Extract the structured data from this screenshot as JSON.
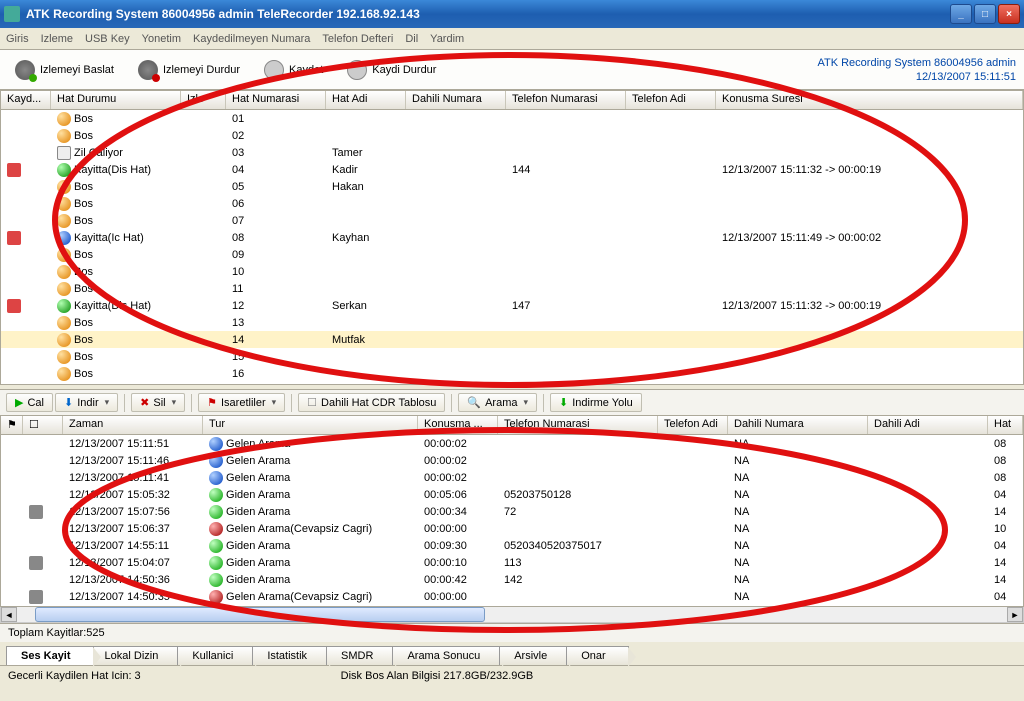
{
  "window": {
    "title": "ATK Recording System 86004956 admin TeleRecorder 192.168.92.143"
  },
  "menu": [
    "Giris",
    "Izleme",
    "USB Key",
    "Yonetim",
    "Kaydedilmeyen Numara",
    "Telefon Defteri",
    "Dil",
    "Yardim"
  ],
  "toolbar": {
    "items": [
      {
        "icon": "headphone-green",
        "label": "Izlemeyi Baslat"
      },
      {
        "icon": "headphone-red",
        "label": "Izlemeyi Durdur"
      },
      {
        "icon": "disk",
        "label": "Kaydet"
      },
      {
        "icon": "disk",
        "label": "Kaydi Durdur"
      }
    ],
    "right1": "ATK Recording System 86004956 admin",
    "right2": "12/13/2007 15:11:51"
  },
  "upper": {
    "headers": [
      "Kayd...",
      "Hat Durumu",
      "Izle",
      "Hat Numarasi",
      "Hat Adi",
      "Dahili Numara",
      "Telefon Numarasi",
      "Telefon Adi",
      "Konusma Suresi"
    ],
    "rows": [
      {
        "rec": "",
        "icon": "orange",
        "durum": "Bos",
        "izle": "",
        "hatno": "01",
        "hatadi": "",
        "dahili": "",
        "tel": "",
        "teladi": "",
        "sure": ""
      },
      {
        "rec": "",
        "icon": "orange",
        "durum": "Bos",
        "izle": "",
        "hatno": "02",
        "hatadi": "",
        "dahili": "",
        "tel": "",
        "teladi": "",
        "sure": ""
      },
      {
        "rec": "",
        "icon": "note",
        "durum": "Zil Caliyor",
        "izle": "",
        "hatno": "03",
        "hatadi": "Tamer",
        "dahili": "",
        "tel": "",
        "teladi": "",
        "sure": ""
      },
      {
        "rec": "r",
        "icon": "greenphone",
        "durum": "Kayitta(Dis Hat)",
        "izle": "",
        "hatno": "04",
        "hatadi": "Kadir",
        "dahili": "",
        "tel": "144",
        "teladi": "",
        "sure": "12/13/2007 15:11:32  -> 00:00:19"
      },
      {
        "rec": "",
        "icon": "orange",
        "durum": "Bos",
        "izle": "",
        "hatno": "05",
        "hatadi": "Hakan",
        "dahili": "",
        "tel": "",
        "teladi": "",
        "sure": ""
      },
      {
        "rec": "",
        "icon": "orange",
        "durum": "Bos",
        "izle": "",
        "hatno": "06",
        "hatadi": "",
        "dahili": "",
        "tel": "",
        "teladi": "",
        "sure": ""
      },
      {
        "rec": "",
        "icon": "orange",
        "durum": "Bos",
        "izle": "",
        "hatno": "07",
        "hatadi": "",
        "dahili": "",
        "tel": "",
        "teladi": "",
        "sure": ""
      },
      {
        "rec": "r",
        "icon": "bluephone",
        "durum": "Kayitta(Ic Hat)",
        "izle": "",
        "hatno": "08",
        "hatadi": "Kayhan",
        "dahili": "",
        "tel": "",
        "teladi": "",
        "sure": "12/13/2007 15:11:49  -> 00:00:02"
      },
      {
        "rec": "",
        "icon": "orange",
        "durum": "Bos",
        "izle": "",
        "hatno": "09",
        "hatadi": "",
        "dahili": "",
        "tel": "",
        "teladi": "",
        "sure": ""
      },
      {
        "rec": "",
        "icon": "orange",
        "durum": "Bos",
        "izle": "",
        "hatno": "10",
        "hatadi": "",
        "dahili": "",
        "tel": "",
        "teladi": "",
        "sure": ""
      },
      {
        "rec": "",
        "icon": "orange",
        "durum": "Bos",
        "izle": "",
        "hatno": "11",
        "hatadi": "",
        "dahili": "",
        "tel": "",
        "teladi": "",
        "sure": ""
      },
      {
        "rec": "r",
        "icon": "greenphone",
        "durum": "Kayitta(Dis Hat)",
        "izle": "",
        "hatno": "12",
        "hatadi": "Serkan",
        "dahili": "",
        "tel": "147",
        "teladi": "",
        "sure": "12/13/2007 15:11:32  -> 00:00:19"
      },
      {
        "rec": "",
        "icon": "orange",
        "durum": "Bos",
        "izle": "",
        "hatno": "13",
        "hatadi": "",
        "dahili": "",
        "tel": "",
        "teladi": "",
        "sure": ""
      },
      {
        "rec": "",
        "icon": "orange",
        "durum": "Bos",
        "izle": "",
        "hatno": "14",
        "hatadi": "Mutfak",
        "dahili": "",
        "tel": "",
        "teladi": "",
        "sure": "",
        "sel": true
      },
      {
        "rec": "",
        "icon": "orange",
        "durum": "Bos",
        "izle": "",
        "hatno": "15",
        "hatadi": "",
        "dahili": "",
        "tel": "",
        "teladi": "",
        "sure": ""
      },
      {
        "rec": "",
        "icon": "orange",
        "durum": "Bos",
        "izle": "",
        "hatno": "16",
        "hatadi": "",
        "dahili": "",
        "tel": "",
        "teladi": "",
        "sure": ""
      }
    ]
  },
  "ltoolbar": [
    {
      "label": "Cal",
      "color": "#0a0",
      "glyph": "▶"
    },
    {
      "label": "Indir",
      "color": "#06c",
      "glyph": "⬇",
      "dd": true
    },
    {
      "sep": true
    },
    {
      "label": "Sil",
      "color": "#c00",
      "glyph": "✖",
      "dd": true
    },
    {
      "sep": true
    },
    {
      "label": "Isaretliler",
      "color": "#c00",
      "glyph": "⚑",
      "dd": true
    },
    {
      "sep": true
    },
    {
      "label": "Dahili Hat CDR Tablosu",
      "color": "#888",
      "glyph": "☐"
    },
    {
      "sep": true
    },
    {
      "label": "Arama",
      "color": "#06c",
      "glyph": "🔍",
      "dd": true
    },
    {
      "sep": true
    },
    {
      "label": "Indirme Yolu",
      "color": "#0a0",
      "glyph": "⬇"
    }
  ],
  "lower": {
    "headers": [
      "⚑",
      "☐",
      "Zaman",
      "Tur",
      "Konusma ...",
      "Telefon Numarasi",
      "Telefon Adi",
      "Dahili Numara",
      "Dahili Adi",
      "Hat"
    ],
    "rows": [
      {
        "f": "",
        "c": "",
        "zaman": "12/13/2007 15:11:51",
        "ticon": "bluephone",
        "tur": "Gelen Arama",
        "kon": "00:00:02",
        "tel": "",
        "tadi": "",
        "dahili": "NA",
        "dadi": "",
        "hat": "08"
      },
      {
        "f": "",
        "c": "",
        "zaman": "12/13/2007 15:11:46",
        "ticon": "bluephone",
        "tur": "Gelen Arama",
        "kon": "00:00:02",
        "tel": "",
        "tadi": "",
        "dahili": "NA",
        "dadi": "",
        "hat": "08"
      },
      {
        "f": "",
        "c": "",
        "zaman": "12/13/2007 15:11:41",
        "ticon": "bluephone",
        "tur": "Gelen Arama",
        "kon": "00:00:02",
        "tel": "",
        "tadi": "",
        "dahili": "NA",
        "dadi": "",
        "hat": "08"
      },
      {
        "f": "",
        "c": "",
        "zaman": "12/13/2007 15:05:32",
        "ticon": "greenout",
        "tur": "Giden Arama",
        "kon": "00:05:06",
        "tel": "05203750128",
        "tadi": "",
        "dahili": "NA",
        "dadi": "",
        "hat": "04"
      },
      {
        "f": "",
        "c": "c",
        "zaman": "12/13/2007 15:07:56",
        "ticon": "greenout",
        "tur": "Giden Arama",
        "kon": "00:00:34",
        "tel": "72",
        "tadi": "",
        "dahili": "NA",
        "dadi": "",
        "hat": "14"
      },
      {
        "f": "",
        "c": "",
        "zaman": "12/13/2007 15:06:37",
        "ticon": "redphone",
        "tur": "Gelen Arama(Cevapsiz Cagri)",
        "kon": "00:00:00",
        "tel": "",
        "tadi": "",
        "dahili": "NA",
        "dadi": "",
        "hat": "10"
      },
      {
        "f": "",
        "c": "",
        "zaman": "12/13/2007 14:55:11",
        "ticon": "greenout",
        "tur": "Giden Arama",
        "kon": "00:09:30",
        "tel": "0520340520375017",
        "tadi": "",
        "dahili": "NA",
        "dadi": "",
        "hat": "04"
      },
      {
        "f": "",
        "c": "c",
        "zaman": "12/13/2007 15:04:07",
        "ticon": "greenout",
        "tur": "Giden Arama",
        "kon": "00:00:10",
        "tel": "113",
        "tadi": "",
        "dahili": "NA",
        "dadi": "",
        "hat": "14"
      },
      {
        "f": "",
        "c": "",
        "zaman": "12/13/2007 14:50:36",
        "ticon": "greenout",
        "tur": "Giden Arama",
        "kon": "00:00:42",
        "tel": "142",
        "tadi": "",
        "dahili": "NA",
        "dadi": "",
        "hat": "14"
      },
      {
        "f": "",
        "c": "c",
        "zaman": "12/13/2007 14:50:35",
        "ticon": "redphone",
        "tur": "Gelen Arama(Cevapsiz Cagri)",
        "kon": "00:00:00",
        "tel": "",
        "tadi": "",
        "dahili": "NA",
        "dadi": "",
        "hat": "04"
      }
    ]
  },
  "totals": "Toplam Kayitlar:525",
  "tabs": [
    "Ses Kayit",
    "Lokal Dizin",
    "Kullanici",
    "Istatistik",
    "SMDR",
    "Arama Sonucu",
    "Arsivle",
    "Onar"
  ],
  "status": {
    "left": "Gecerli Kaydilen Hat Icin: 3",
    "center": "Disk Bos Alan Bilgisi 217.8GB/232.9GB"
  }
}
